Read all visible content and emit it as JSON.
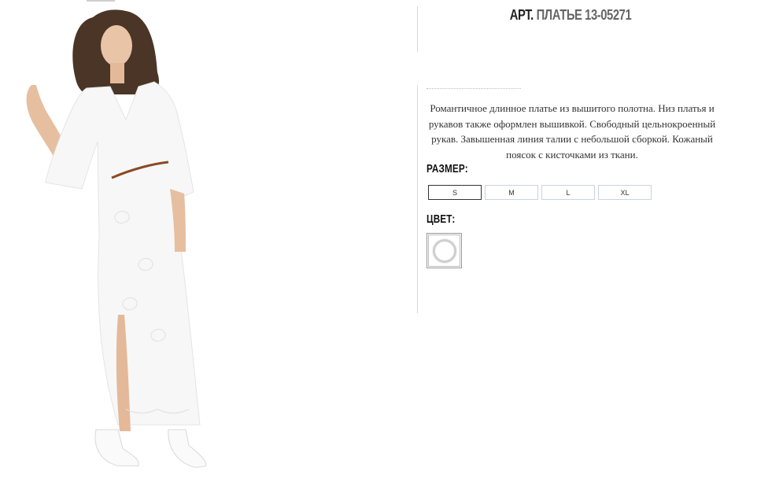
{
  "product": {
    "title_prefix": "АРТ.",
    "title_name": "ПЛАТЬЕ 13-05271",
    "description": "Романтичное длинное платье из вышитого полотна. Низ платья и рукавов также оформлен вышивкой. Свободный цельнокроенный рукав. Завышенная линия талии с небольшой сборкой. Кожаный поясок с кисточками из ткани."
  },
  "size": {
    "label": "РАЗМЕР:",
    "options": [
      "S",
      "M",
      "L",
      "XL"
    ],
    "selected": "S"
  },
  "color": {
    "label": "ЦВЕТ:",
    "swatch_color": "#ffffff"
  },
  "photo": {
    "icon": "dress-model-photo"
  }
}
